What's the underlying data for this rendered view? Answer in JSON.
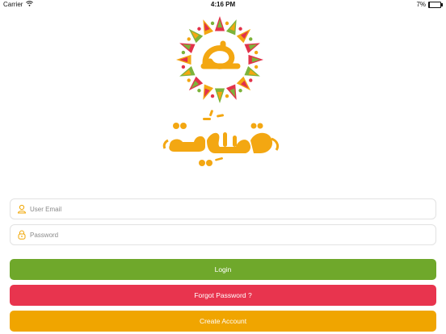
{
  "status_bar": {
    "carrier": "Carrier",
    "time": "4:16 PM",
    "battery_text": "7%",
    "battery_level": 0.07
  },
  "form": {
    "email_placeholder": "User Email",
    "email_value": "",
    "password_placeholder": "Password",
    "password_value": ""
  },
  "buttons": {
    "login_label": "Login",
    "forgot_label": "Forgot Password ?",
    "create_label": "Create Account"
  },
  "colors": {
    "login": "#6fa82b",
    "forgot": "#e8344e",
    "create": "#f0a500",
    "brand_orange": "#f3a712",
    "brand_green": "#7cb33a",
    "brand_red": "#e2324a",
    "icon_orange": "#f0a500"
  }
}
